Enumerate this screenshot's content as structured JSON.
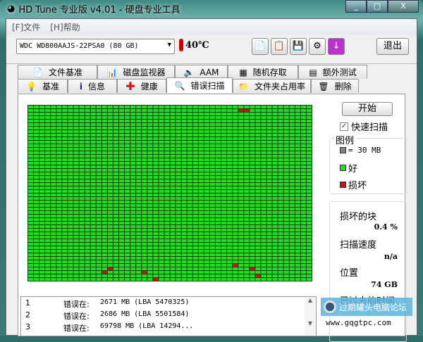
{
  "window": {
    "title": "HD Tune 专业版 v4.01 - 硬盘专业工具",
    "minimize": "_",
    "maximize": "□",
    "close": "X"
  },
  "menu": [
    "[F]文件",
    "[H]帮助"
  ],
  "toolbar": {
    "drive": "WDC WD800AAJS-22PSA0 (80 GB)",
    "temperature": "40℃",
    "exit": "退出",
    "icons": [
      "copy-text-icon",
      "copy-screenshot-icon",
      "save-icon",
      "options-icon",
      "download-icon"
    ]
  },
  "tabs": {
    "row1": [
      "文件基准",
      "磁盘监视器",
      "AAM",
      "随机存取",
      "额外测试"
    ],
    "row2": [
      "基准",
      "信息",
      "健康",
      "错误扫描",
      "文件夹占用率",
      "删除"
    ],
    "active": "错误扫描"
  },
  "scan": {
    "start": "开始",
    "quick_scan": "快速扫描",
    "quick_scan_checked": true,
    "grid": {
      "cols": 50,
      "rows": 50,
      "bad_blocks": [
        [
          1,
          37
        ],
        [
          1,
          38
        ],
        [
          45,
          36
        ],
        [
          46,
          14
        ],
        [
          46,
          39
        ],
        [
          47,
          13
        ],
        [
          47,
          20
        ],
        [
          48,
          40
        ],
        [
          49,
          22
        ]
      ]
    },
    "legend": {
      "title": "图例",
      "block": "= 30 MB",
      "good": "好",
      "bad": "损坏"
    },
    "colors": {
      "good": "#22dd22",
      "bad": "#cc1111",
      "block": "#808080"
    },
    "stats": {
      "bad_blocks_label": "损坏的块",
      "bad_blocks_value": "0.4 %",
      "speed_label": "扫描速度",
      "speed_value": "n/a",
      "position_label": "位置",
      "position_value": "74 GB",
      "elapsed_label": "已过去的时间"
    },
    "log": [
      {
        "n": "1",
        "label": "错误在:",
        "value": "2671 MB  (LBA 5470325)"
      },
      {
        "n": "2",
        "label": "错误在:",
        "value": "2686 MB  (LBA 5501584)"
      },
      {
        "n": "3",
        "label": "错误在:",
        "value": "69798 MB  (LBA 14294..."
      }
    ]
  },
  "watermark": {
    "text": "过期罐头电脑论坛",
    "url": "www.gqgtpc.com"
  }
}
